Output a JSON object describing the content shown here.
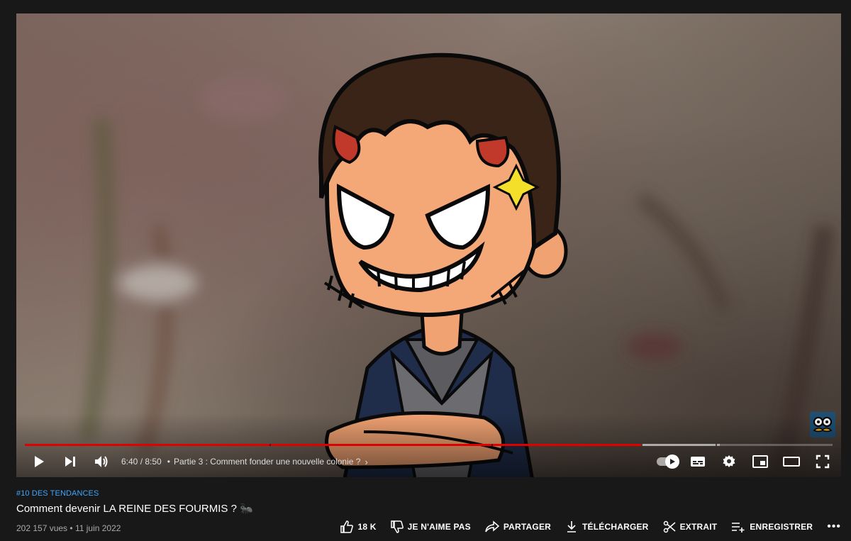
{
  "player": {
    "time_current": "6:40",
    "time_total": "8:50",
    "time_separator": " / ",
    "progress_fraction": 0.763,
    "chapter_label": "Partie 3 : Comment fonder une nouvelle colonie ?",
    "accent_color": "#e00000"
  },
  "video": {
    "trending_tag": "#10 DES TENDANCES",
    "title": "Comment devenir LA REINE DES FOURMIS ?",
    "title_emoji": "🐜",
    "views": "202 157 vues",
    "date": "11 juin 2022",
    "meta_separator": " • "
  },
  "actions": {
    "like_count": "18 K",
    "dislike_label": "JE N'AIME PAS",
    "share_label": "PARTAGER",
    "download_label": "TÉLÉCHARGER",
    "clip_label": "EXTRAIT",
    "save_label": "ENREGISTRER",
    "more_label": "•••"
  },
  "icons": {
    "play": "play-icon",
    "next": "next-icon",
    "volume": "volume-icon",
    "autoplay": "autoplay-toggle-icon",
    "subtitles": "subtitles-icon",
    "settings": "gear-icon",
    "miniplayer": "miniplayer-icon",
    "theater": "theater-mode-icon",
    "fullscreen": "fullscreen-icon"
  }
}
